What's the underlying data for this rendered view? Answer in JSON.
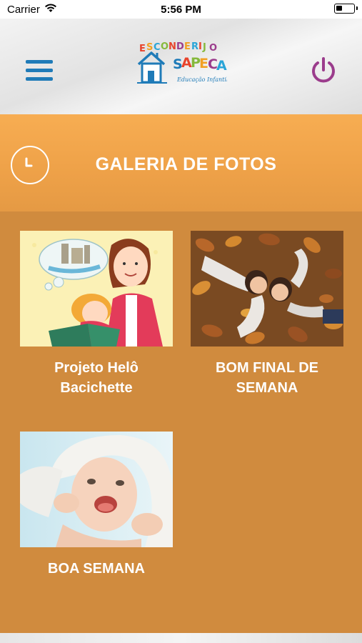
{
  "status_bar": {
    "carrier": "Carrier",
    "time": "5:56 PM",
    "battery_level": 0.35
  },
  "header": {
    "logo_text_line1": "ESCONDERIJO",
    "logo_text_line2": "SAPECA",
    "logo_tagline": "Educação Infantil",
    "menu_icon": "hamburger-icon",
    "power_icon": "power-icon",
    "power_color": "#9b3c8c",
    "menu_color": "#1f7bb8"
  },
  "banner": {
    "title": "GALERIA DE FOTOS",
    "icon": "clock-icon",
    "color": "#f2a54c"
  },
  "gallery": {
    "background": "#d08b3e",
    "items": [
      {
        "caption_line1": "Projeto Helô",
        "caption_line2": "Bacichette",
        "image": "illustration of mother and daughter reading"
      },
      {
        "caption_line1": "BOM FINAL DE",
        "caption_line2": "SEMANA",
        "image": "children lying on autumn leaves"
      },
      {
        "caption_line1": "BOA SEMANA",
        "caption_line2": "",
        "image": "smiling baby in white towel"
      }
    ]
  }
}
